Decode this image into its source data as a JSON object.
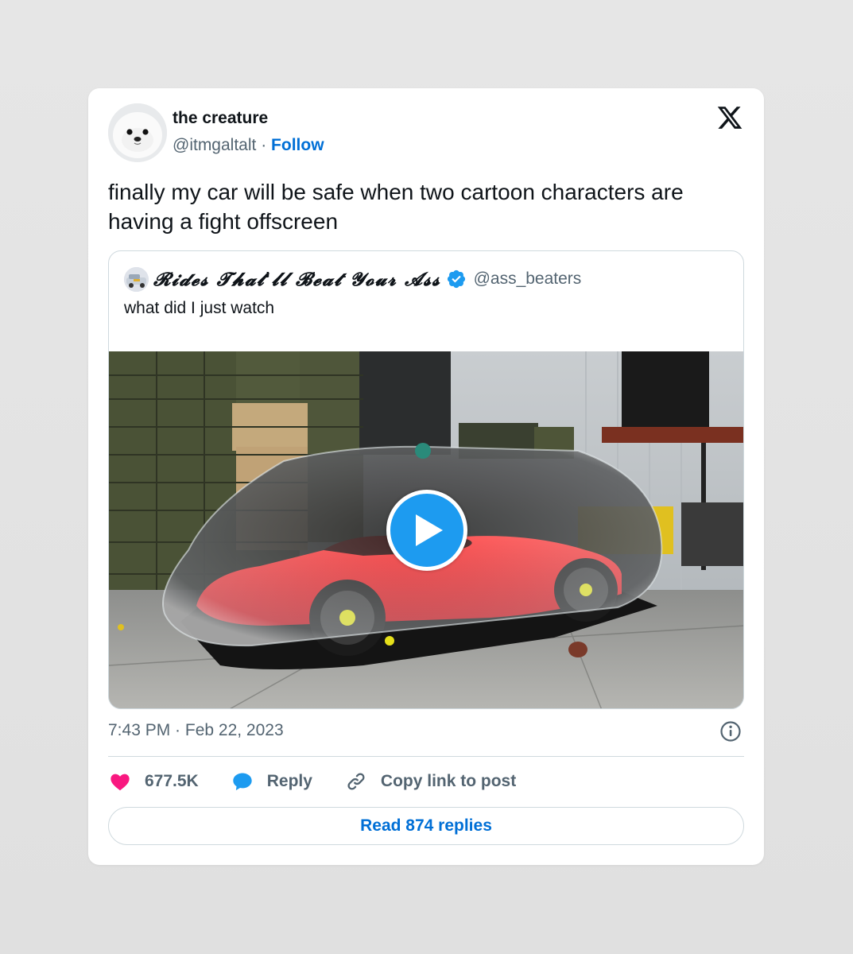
{
  "author": {
    "name": "the creature",
    "handle": "@itmgaltalt",
    "separator": "·",
    "follow_label": "Follow"
  },
  "tweet": {
    "text": "finally my car will be safe when two cartoon characters are having a fight offscreen",
    "timestamp": "7:43 PM · Feb 22, 2023"
  },
  "quote": {
    "name": "𝓡𝓲𝓭𝓮𝓼 𝓣𝓱𝓪𝓽'𝓵𝓵 𝓑𝓮𝓪𝓽 𝓨𝓸𝓾𝓻 𝓐𝓼𝓼",
    "handle": "@ass_beaters",
    "text": "what did I just watch"
  },
  "actions": {
    "likes": "677.5K",
    "reply_label": "Reply",
    "copy_label": "Copy link to post"
  },
  "read_replies_label": "Read 874 replies",
  "colors": {
    "accent": "#1d9bf0",
    "link": "#006fd6",
    "like": "#f91880",
    "text": "#0f1419",
    "muted": "#536471"
  },
  "icons": [
    "x-logo-icon",
    "verified-badge-icon",
    "play-icon",
    "info-icon",
    "heart-icon",
    "reply-bubble-icon",
    "link-icon"
  ]
}
